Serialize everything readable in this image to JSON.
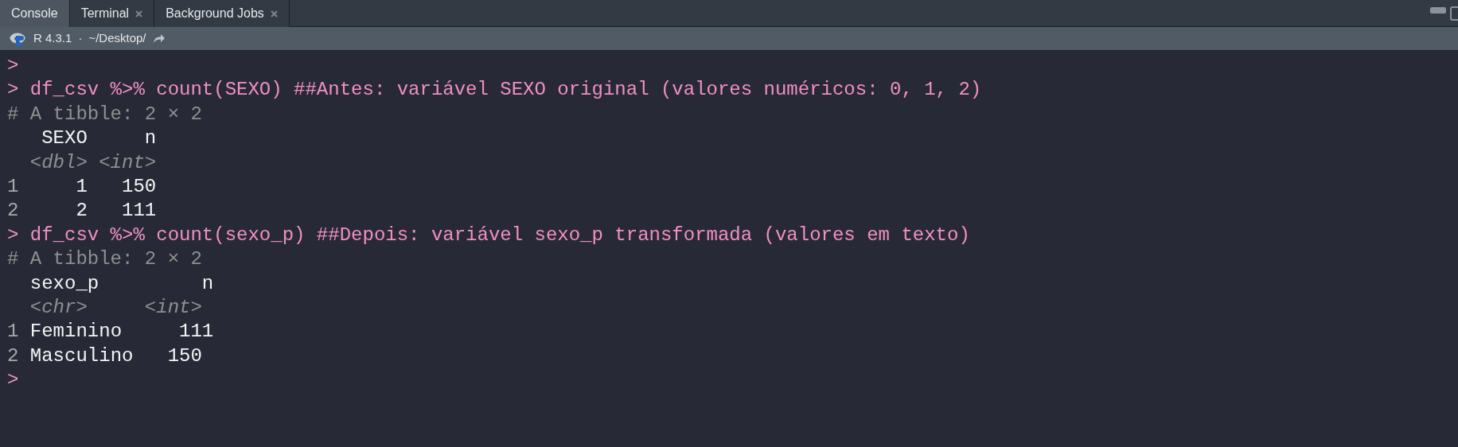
{
  "tabs": [
    {
      "label": "Console",
      "selected": true,
      "closable": false
    },
    {
      "label": "Terminal",
      "selected": false,
      "closable": true
    },
    {
      "label": "Background Jobs",
      "selected": false,
      "closable": true
    }
  ],
  "toolbar": {
    "version": "R 4.3.1",
    "separator": "·",
    "path": "~/Desktop/"
  },
  "console": [
    {
      "kind": "prompt",
      "text": ">"
    },
    {
      "kind": "prompt",
      "text": "> df_csv %>% count(SEXO) ##Antes: variável SEXO original (valores numéricos: 0, 1, 2)"
    },
    {
      "kind": "comment",
      "text": "# A tibble: 2 × 2"
    },
    {
      "kind": "header",
      "text": "   SEXO     n"
    },
    {
      "kind": "types",
      "text": "  <dbl> <int>"
    },
    {
      "kind": "row",
      "index": "1",
      "text": "     1   150"
    },
    {
      "kind": "row",
      "index": "2",
      "text": "     2   111"
    },
    {
      "kind": "prompt",
      "text": "> df_csv %>% count(sexo_p) ##Depois: variável sexo_p transformada (valores em texto)"
    },
    {
      "kind": "comment",
      "text": "# A tibble: 2 × 2"
    },
    {
      "kind": "header",
      "text": "  sexo_p         n"
    },
    {
      "kind": "types",
      "text": "  <chr>     <int>"
    },
    {
      "kind": "row",
      "index": "1",
      "text": " Feminino     111"
    },
    {
      "kind": "row",
      "index": "2",
      "text": " Masculino   150"
    },
    {
      "kind": "prompt",
      "text": ">"
    }
  ]
}
